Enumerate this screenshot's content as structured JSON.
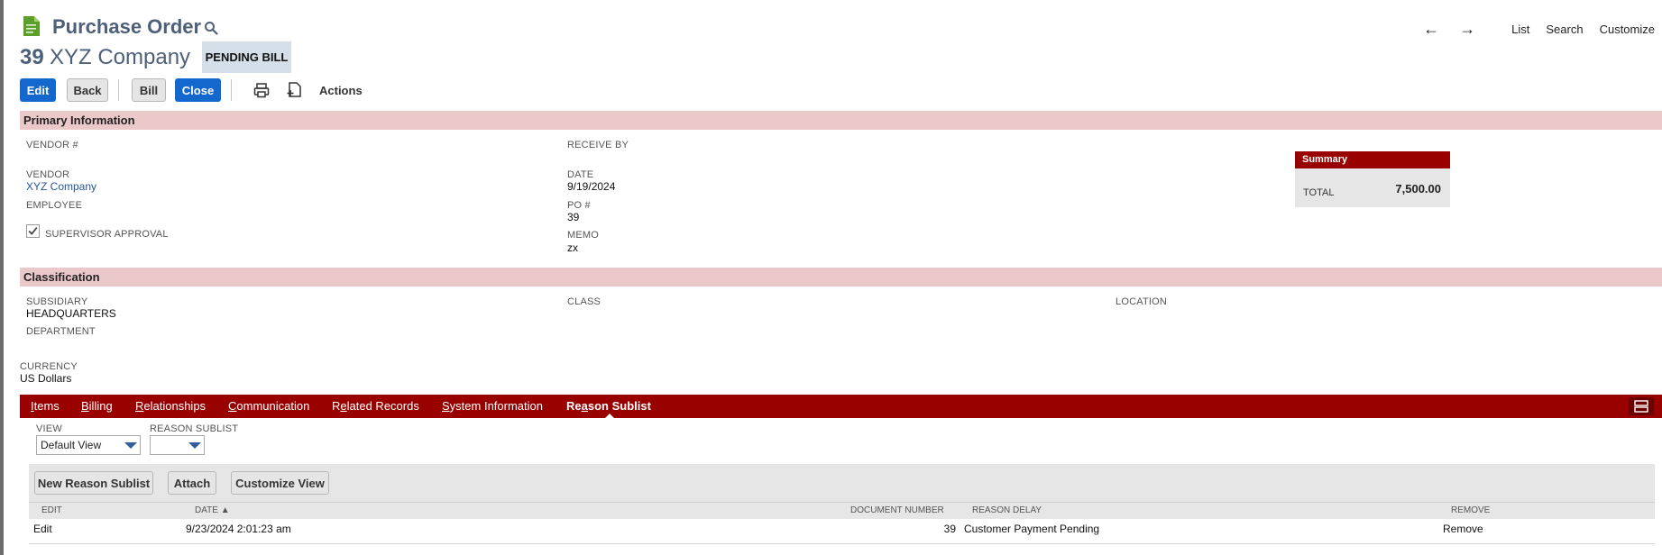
{
  "header": {
    "title": "Purchase Order",
    "record_number": "39",
    "record_name": "XYZ Company",
    "status": "PENDING BILL"
  },
  "topnav": {
    "prev_arrow": "←",
    "next_arrow": "→",
    "list": "List",
    "search": "Search",
    "customize": "Customize"
  },
  "toolbar": {
    "edit": "Edit",
    "back": "Back",
    "bill": "Bill",
    "close": "Close",
    "actions": "Actions"
  },
  "primary": {
    "title": "Primary Information",
    "vendor_num_label": "VENDOR #",
    "vendor_label": "VENDOR",
    "vendor_value": "XYZ Company",
    "employee_label": "EMPLOYEE",
    "supervisor_label": "SUPERVISOR APPROVAL",
    "supervisor_checked": true,
    "receive_by_label": "RECEIVE BY",
    "date_label": "DATE",
    "date_value": "9/19/2024",
    "po_label": "PO #",
    "po_value": "39",
    "memo_label": "MEMO",
    "memo_value": "zx"
  },
  "summary": {
    "title": "Summary",
    "total_label": "TOTAL",
    "total_value": "7,500.00"
  },
  "classification": {
    "title": "Classification",
    "subsidiary_label": "SUBSIDIARY",
    "subsidiary_value": "HEADQUARTERS",
    "department_label": "DEPARTMENT",
    "class_label": "CLASS",
    "location_label": "LOCATION"
  },
  "currency": {
    "label": "CURRENCY",
    "value": "US Dollars"
  },
  "tabs": [
    {
      "first": "I",
      "rest": "tems"
    },
    {
      "first": "B",
      "rest": "illing"
    },
    {
      "first": "R",
      "rest": "elationships"
    },
    {
      "first": "C",
      "rest": "ommunication"
    },
    {
      "pre": "R",
      "first": "e",
      "rest": "lated Records"
    },
    {
      "first": "S",
      "rest": "ystem Information"
    },
    {
      "pre": "Re",
      "first": "a",
      "rest": "son Sublist"
    }
  ],
  "sublist": {
    "view_label": "VIEW",
    "view_value": "Default View",
    "reason_label": "REASON SUBLIST",
    "reason_value": "",
    "new_button": "New Reason Sublist",
    "attach_button": "Attach",
    "customize_button": "Customize View",
    "columns": {
      "edit": "EDIT",
      "date": "DATE ▲",
      "doc": "DOCUMENT NUMBER",
      "reason": "REASON DELAY",
      "remove": "REMOVE"
    },
    "rows": [
      {
        "edit": "Edit",
        "date": "9/23/2024 2:01:23 am",
        "doc": "39",
        "reason": "Customer Payment Pending",
        "remove": "Remove"
      }
    ]
  },
  "colors": {
    "brand_red": "#990000",
    "section_bar": "#ebc9ca",
    "primary_blue": "#1467cc",
    "title_slate": "#4d5f79"
  }
}
